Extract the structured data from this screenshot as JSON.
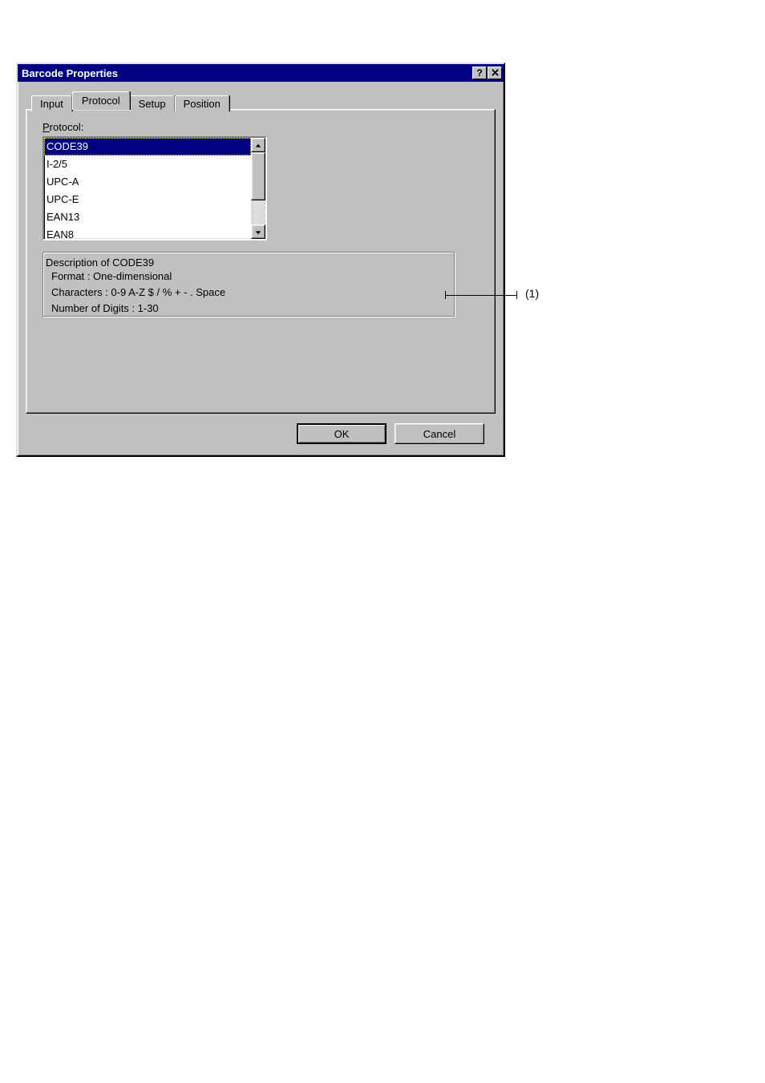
{
  "window": {
    "title": "Barcode Properties"
  },
  "tabs": {
    "items": [
      {
        "label": "Input"
      },
      {
        "label": "Protocol"
      },
      {
        "label": "Setup"
      },
      {
        "label": "Position"
      }
    ]
  },
  "protocol": {
    "label_prefix": "P",
    "label_rest": "rotocol:",
    "options": [
      "CODE39",
      "I-2/5",
      "UPC-A",
      "UPC-E",
      "EAN13",
      "EAN8"
    ]
  },
  "description": {
    "title": "Description of CODE39",
    "lines": [
      "Format : One-dimensional",
      "Characters : 0-9 A-Z $ / % + - . Space",
      "Number of Digits : 1-30"
    ]
  },
  "buttons": {
    "ok": "OK",
    "cancel": "Cancel"
  },
  "annotation": {
    "label": "(1)"
  }
}
